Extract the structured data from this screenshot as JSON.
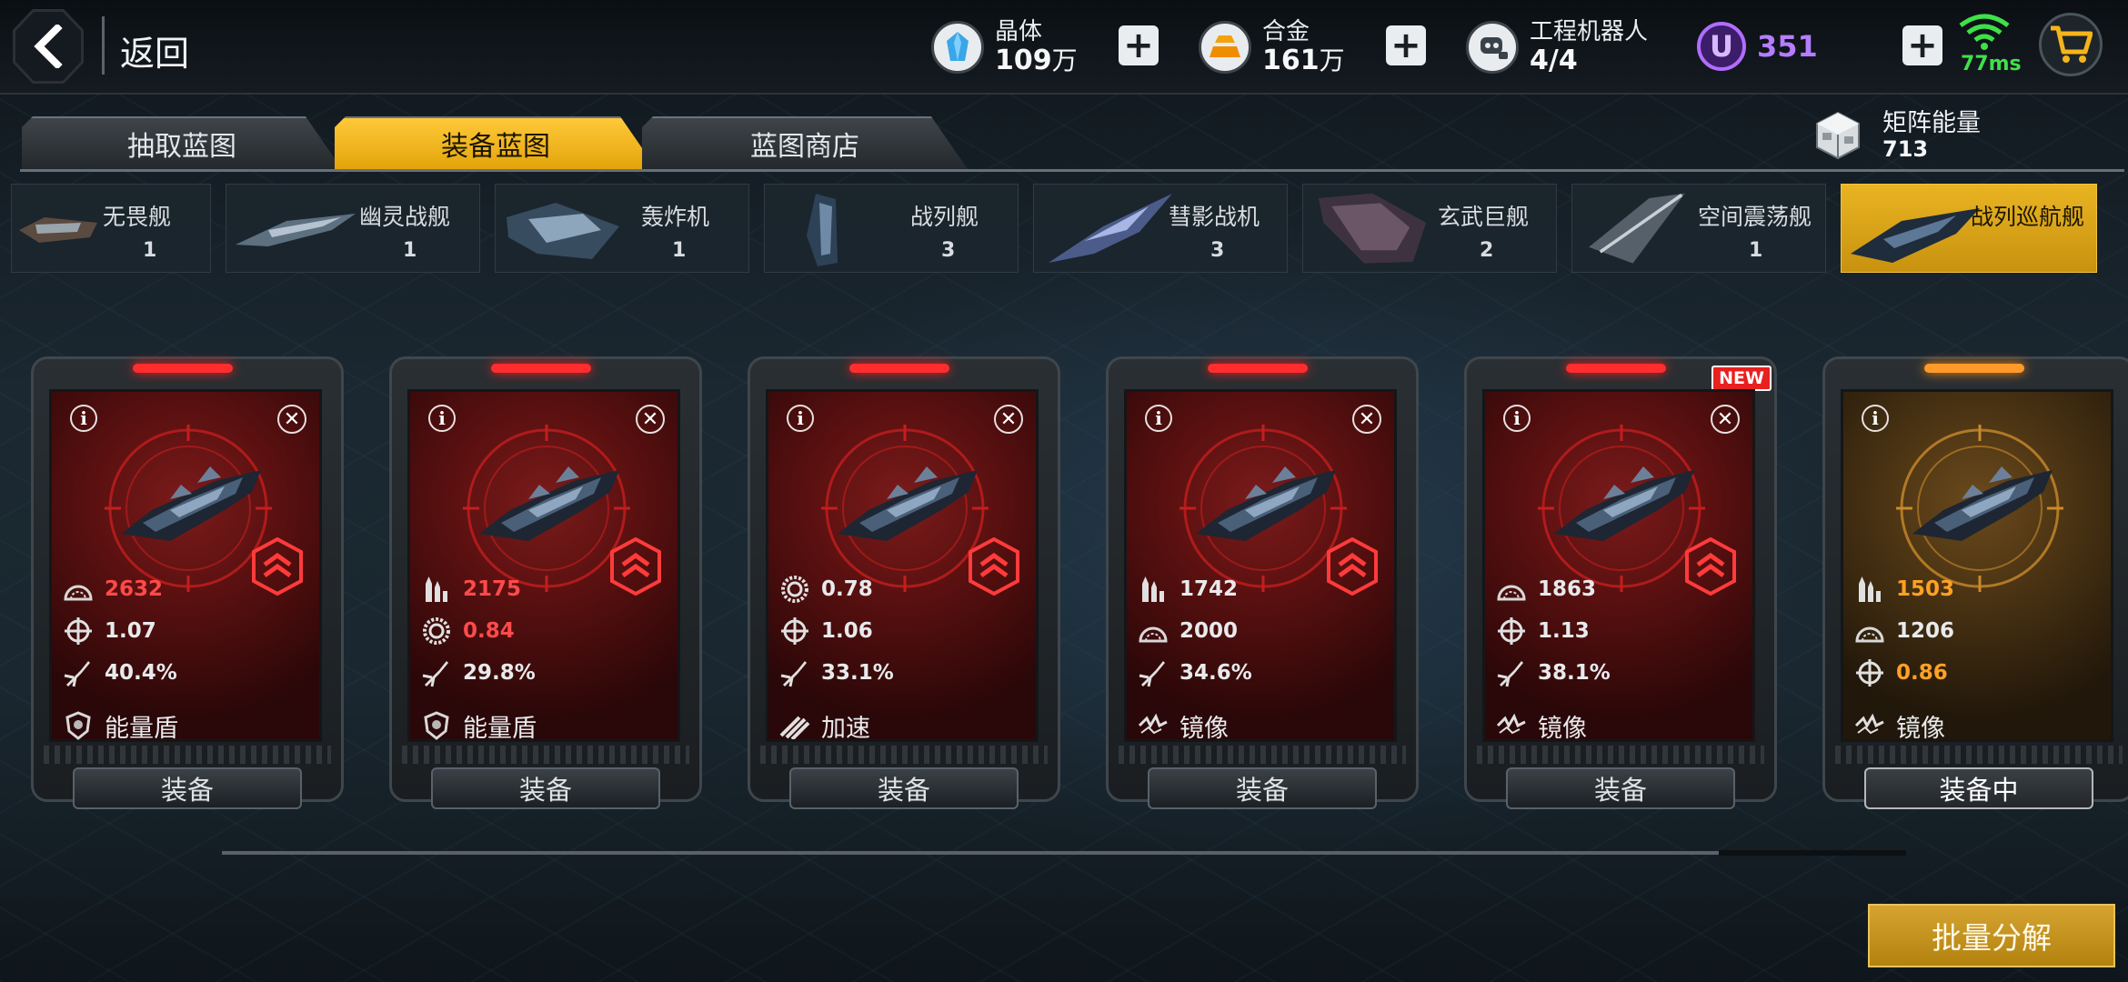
{
  "header": {
    "back_label": "返回",
    "resources": [
      {
        "name": "晶体",
        "value": "109",
        "unit": "万",
        "icon": "crystal-icon"
      },
      {
        "name": "合金",
        "value": "161",
        "unit": "万",
        "icon": "alloy-icon"
      },
      {
        "name": "工程机器人",
        "value": "4/4",
        "unit": "",
        "icon": "robot-icon"
      }
    ],
    "u_coin_symbol": "U",
    "u_coin_value": "351",
    "ping": "77ms"
  },
  "tabs": [
    {
      "label": "抽取蓝图",
      "active": false
    },
    {
      "label": "装备蓝图",
      "active": true
    },
    {
      "label": "蓝图商店",
      "active": false
    }
  ],
  "matrix": {
    "name": "矩阵能量",
    "value": "713"
  },
  "ship_types": [
    {
      "name": "无畏舰",
      "count": "1",
      "active": false
    },
    {
      "name": "幽灵战舰",
      "count": "1",
      "active": false
    },
    {
      "name": "轰炸机",
      "count": "1",
      "active": false
    },
    {
      "name": "战列舰",
      "count": "3",
      "active": false
    },
    {
      "name": "彗影战机",
      "count": "3",
      "active": false
    },
    {
      "name": "玄武巨舰",
      "count": "2",
      "active": false
    },
    {
      "name": "空间震荡舰",
      "count": "1",
      "active": false
    },
    {
      "name": "战列巡航舰",
      "count": "",
      "active": true
    }
  ],
  "cards": [
    {
      "theme": "red",
      "is_new": false,
      "stats": [
        {
          "icon": "armor-dome-icon",
          "value": "2632",
          "color": "red"
        },
        {
          "icon": "crosshair-icon",
          "value": "1.07",
          "color": "white"
        },
        {
          "icon": "missile-icon",
          "value": "40.4%",
          "color": "white"
        }
      ],
      "skill": {
        "icon": "shield-icon",
        "label": "能量盾"
      },
      "button": "装备"
    },
    {
      "theme": "red",
      "is_new": false,
      "stats": [
        {
          "icon": "ammo-icon",
          "value": "2175",
          "color": "red"
        },
        {
          "icon": "gear-ring-icon",
          "value": "0.84",
          "color": "red"
        },
        {
          "icon": "missile-icon",
          "value": "29.8%",
          "color": "white"
        }
      ],
      "skill": {
        "icon": "shield-icon",
        "label": "能量盾"
      },
      "button": "装备"
    },
    {
      "theme": "red",
      "is_new": false,
      "stats": [
        {
          "icon": "gear-ring-icon",
          "value": "0.78",
          "color": "white"
        },
        {
          "icon": "crosshair-icon",
          "value": "1.06",
          "color": "white"
        },
        {
          "icon": "missile-icon",
          "value": "33.1%",
          "color": "white"
        }
      ],
      "skill": {
        "icon": "speed-icon",
        "label": "加速"
      },
      "button": "装备"
    },
    {
      "theme": "red",
      "is_new": false,
      "stats": [
        {
          "icon": "ammo-icon",
          "value": "1742",
          "color": "white"
        },
        {
          "icon": "armor-dome-icon",
          "value": "2000",
          "color": "white"
        },
        {
          "icon": "missile-icon",
          "value": "34.6%",
          "color": "white"
        }
      ],
      "skill": {
        "icon": "mirror-icon",
        "label": "镜像"
      },
      "button": "装备"
    },
    {
      "theme": "red",
      "is_new": true,
      "new_label": "NEW",
      "stats": [
        {
          "icon": "armor-dome-icon",
          "value": "1863",
          "color": "white"
        },
        {
          "icon": "crosshair-icon",
          "value": "1.13",
          "color": "white"
        },
        {
          "icon": "missile-icon",
          "value": "38.1%",
          "color": "white"
        }
      ],
      "skill": {
        "icon": "mirror-icon",
        "label": "镜像"
      },
      "button": "装备"
    },
    {
      "theme": "gold",
      "is_new": false,
      "stats": [
        {
          "icon": "ammo-icon",
          "value": "1503",
          "color": "orange"
        },
        {
          "icon": "armor-dome-icon",
          "value": "1206",
          "color": "white"
        },
        {
          "icon": "crosshair-icon",
          "value": "0.86",
          "color": "orange"
        }
      ],
      "skill": {
        "icon": "mirror-icon",
        "label": "镜像"
      },
      "button": "装备中"
    }
  ],
  "bottom_button": "批量分解",
  "colors": {
    "accent_gold": "#e3a40a",
    "stat_red": "#ff4a4a",
    "stat_orange": "#ffa126",
    "ping_green": "#40e04a",
    "u_purple": "#b57dff"
  }
}
